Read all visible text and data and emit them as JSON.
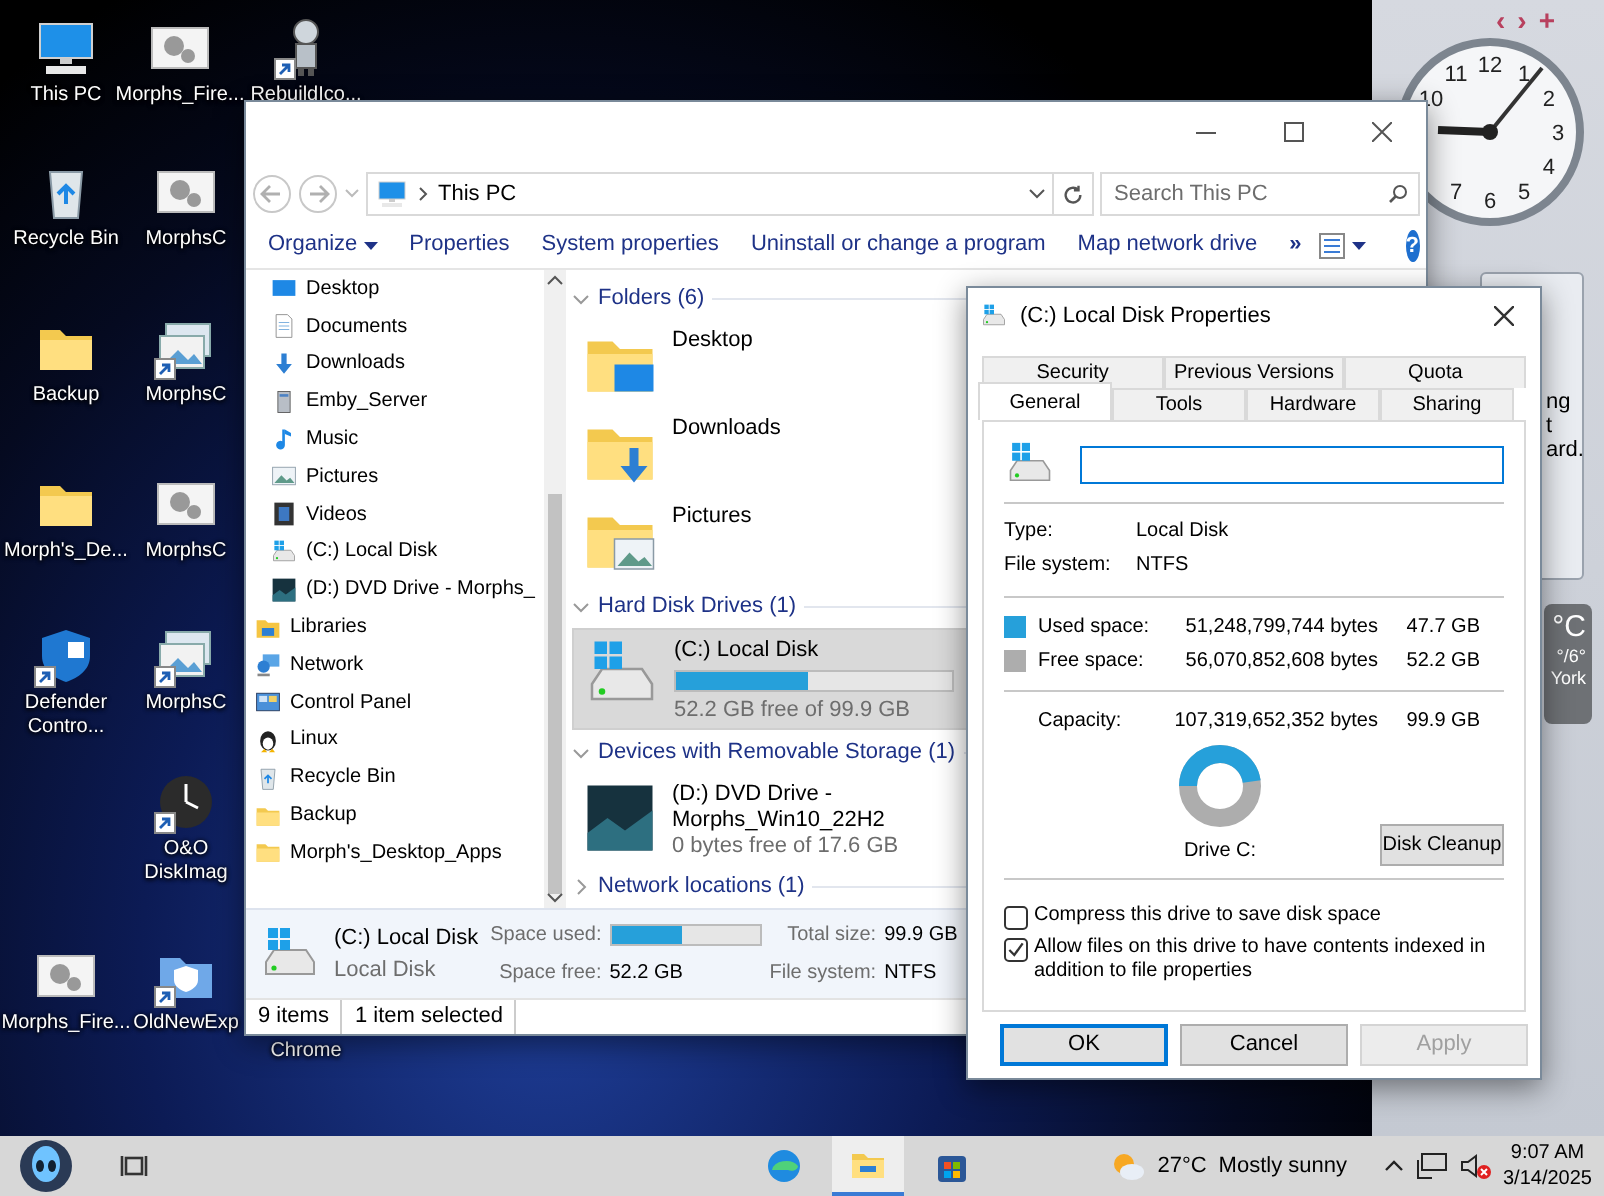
{
  "desktop": {
    "columns": [
      [
        {
          "label": "This PC",
          "kind": "pc",
          "shortcut": false
        },
        {
          "label": "Recycle Bin",
          "kind": "recycle",
          "shortcut": false
        },
        {
          "label": "Backup",
          "kind": "folder",
          "shortcut": false
        },
        {
          "label": "Morph's_De...",
          "kind": "folder",
          "shortcut": false
        },
        {
          "label": "Defender Contro...",
          "kind": "shield",
          "shortcut": true
        },
        {
          "label": "Morphs_Fire...",
          "kind": "app",
          "shortcut": false
        }
      ],
      [
        {
          "label": "Morphs_Fire...",
          "kind": "app",
          "shortcut": false
        },
        {
          "label": "MorphsC",
          "kind": "app",
          "shortcut": false
        },
        {
          "label": "MorphsC",
          "kind": "photos",
          "shortcut": true
        },
        {
          "label": "MorphsC",
          "kind": "app",
          "shortcut": false
        },
        {
          "label": "MorphsC",
          "kind": "photos",
          "shortcut": true
        },
        {
          "label": "O&O DiskImag",
          "kind": "disk-clock",
          "shortcut": true
        },
        {
          "label": "OldNewExp",
          "kind": "shield-folder",
          "shortcut": true
        }
      ],
      [
        {
          "label": "RebuildIco...",
          "kind": "robot",
          "shortcut": true
        },
        {
          "label": "Chrome",
          "kind": "covered",
          "shortcut": false
        }
      ]
    ]
  },
  "gadgets": {
    "controls": [
      "‹",
      "›",
      "+"
    ],
    "clock": {
      "numerals": [
        "12",
        "1",
        "2",
        "3",
        "4",
        "5",
        "6",
        "7",
        "10",
        "11"
      ]
    },
    "note_fragments": [
      "ng",
      "t",
      "ard."
    ],
    "weather": {
      "temperature": "°C",
      "range": "°/6°",
      "city": "York"
    }
  },
  "explorer": {
    "address": {
      "path": "This PC"
    },
    "search": {
      "placeholder": "Search This PC"
    },
    "toolbar": {
      "items": [
        {
          "label": "Organize",
          "dropdown": true
        },
        {
          "label": "Properties",
          "dropdown": false
        },
        {
          "label": "System properties",
          "dropdown": false
        },
        {
          "label": "Uninstall or change a program",
          "dropdown": false
        },
        {
          "label": "Map network drive",
          "dropdown": false
        }
      ],
      "overflow": "»",
      "help": "?"
    },
    "nav_pane": {
      "items": [
        {
          "children": [
            {
              "label": "Desktop",
              "kind": "desktop"
            },
            {
              "label": "Documents",
              "kind": "documents"
            },
            {
              "label": "Downloads",
              "kind": "download"
            },
            {
              "label": "Emby_Server",
              "kind": "server"
            },
            {
              "label": "Music",
              "kind": "music"
            },
            {
              "label": "Pictures",
              "kind": "pictures"
            },
            {
              "label": "Videos",
              "kind": "videos"
            },
            {
              "label": "(C:) Local Disk",
              "kind": "drive"
            },
            {
              "label": "(D:) DVD Drive - Morphs_",
              "kind": "dvd"
            }
          ]
        },
        {
          "label": "Libraries",
          "kind": "libraries"
        },
        {
          "label": "Network",
          "kind": "network"
        },
        {
          "label": "Control Panel",
          "kind": "controlpanel"
        },
        {
          "label": "Linux",
          "kind": "linux"
        },
        {
          "label": "Recycle Bin",
          "kind": "recycle"
        },
        {
          "label": "Backup",
          "kind": "folder"
        },
        {
          "label": "Morph's_Desktop_Apps",
          "kind": "folder"
        }
      ]
    },
    "content": {
      "groups": [
        {
          "title": "Folders (6)",
          "expanded": true,
          "items": [
            {
              "label": "Desktop",
              "kind": "desktop",
              "selected": false
            },
            {
              "label": "Downloads",
              "kind": "download",
              "selected": false
            },
            {
              "label": "Pictures",
              "kind": "pictures",
              "selected": false
            }
          ]
        },
        {
          "title": "Hard Disk Drives (1)",
          "expanded": true,
          "items": [
            {
              "label": "(C:) Local Disk",
              "kind": "drive",
              "selected": true,
              "level": 0.477,
              "free": "52.2 GB free of 99.9 GB"
            }
          ]
        },
        {
          "title": "Devices with Removable Storage (1)",
          "expanded": true,
          "items": [
            {
              "label": "(D:) DVD Drive - Morphs_Win10_22H2",
              "kind": "dvd",
              "selected": false,
              "free": "0 bytes free of 17.6 GB"
            }
          ]
        },
        {
          "title": "Network locations (1)",
          "expanded": false
        }
      ]
    },
    "details": {
      "name": "(C:) Local Disk",
      "type": "Local Disk",
      "fields": [
        {
          "label": "Space used:",
          "level": 0.477
        },
        {
          "label": "Total size:",
          "value": "99.9 GB"
        },
        {
          "label": "Space free:",
          "value": "52.2 GB"
        },
        {
          "label": "File system:",
          "value": "NTFS"
        }
      ]
    },
    "status_bar": [
      "9 items",
      "1 item selected"
    ]
  },
  "dialog": {
    "title": "(C:) Local Disk Properties",
    "tab_rows": [
      [
        {
          "label": "Security",
          "selected": false
        },
        {
          "label": "Previous Versions",
          "selected": false
        },
        {
          "label": "Quota",
          "selected": false
        }
      ],
      [
        {
          "label": "General",
          "selected": true
        },
        {
          "label": "Tools",
          "selected": false
        },
        {
          "label": "Hardware",
          "selected": false
        },
        {
          "label": "Sharing",
          "selected": false
        }
      ]
    ],
    "info": [
      {
        "label": "Type:",
        "value": "Local Disk"
      },
      {
        "label": "File system:",
        "value": "NTFS"
      }
    ],
    "space": [
      {
        "label": "Used space:",
        "bytes": "51,248,799,744 bytes",
        "size": "47.7 GB",
        "color": "#26a0da"
      },
      {
        "label": "Free space:",
        "bytes": "56,070,852,608 bytes",
        "size": "52.2 GB",
        "color": "#adadad"
      }
    ],
    "capacity": {
      "label": "Capacity:",
      "bytes": "107,319,652,352 bytes",
      "size": "99.9 GB"
    },
    "donut": {
      "level": 0.477
    },
    "drive_label": "Drive C:",
    "cleanup_button": "Disk Cleanup",
    "checkboxes": [
      {
        "label": "Compress this drive to save disk space",
        "checked": false
      },
      {
        "label": "Allow files on this drive to have contents indexed in addition to file properties",
        "checked": true
      }
    ],
    "buttons": [
      {
        "label": "OK",
        "default": true,
        "disabled": false
      },
      {
        "label": "Cancel",
        "default": false,
        "disabled": false
      },
      {
        "label": "Apply",
        "default": false,
        "disabled": true
      }
    ]
  },
  "taskbar": {
    "apps": [
      {
        "kind": "edge",
        "selected": false
      },
      {
        "kind": "explorer",
        "selected": true
      },
      {
        "kind": "store",
        "selected": false
      }
    ],
    "weather": {
      "temperature": "27°C",
      "condition": "Mostly sunny"
    },
    "clock": {
      "time": "9:07 AM",
      "date": "3/14/2025"
    }
  }
}
